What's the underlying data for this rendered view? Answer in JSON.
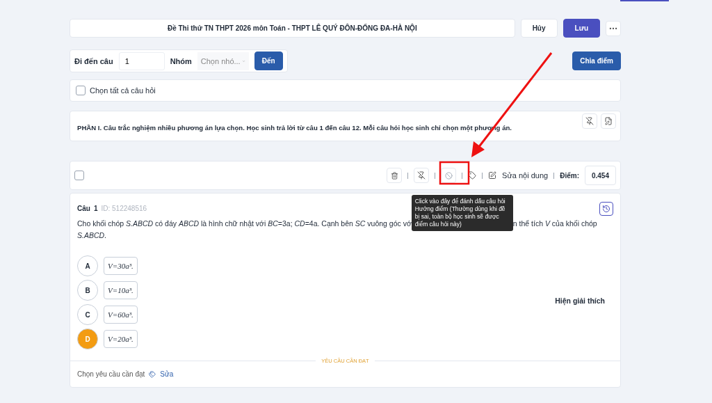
{
  "header": {
    "title": "Đề Thi thử TN THPT 2026 môn Toán - THPT LÊ QUÝ ĐÔN-ĐỐNG ĐA-HÀ NỘI",
    "buttons": [
      {
        "label": "Hủy",
        "kind": "secondary"
      },
      {
        "label": "Lưu",
        "kind": "primary"
      }
    ]
  },
  "goto": {
    "label": "Đi đến câu",
    "value": "1",
    "group_label": "Nhóm",
    "group_placeholder": "Chọn nhó...",
    "button": "Đến"
  },
  "distribute_button": "Chia điểm",
  "select_all": {
    "label": "Chọn tất cả câu hỏi",
    "checked": false
  },
  "section": {
    "text": "PHẦN I. Câu trắc nghiệm nhiều phương án lựa chọn. Học sinh trả lời từ câu 1 đến câu 12. Mỗi câu hỏi học sinh chỉ chọn một phương án."
  },
  "question_toolbar": {
    "checked": false,
    "edit_label": "Sửa nội dung",
    "score_label": "Điểm:",
    "score": "0.454"
  },
  "tooltip": "Click vào đây để đánh dấu câu hỏi Hưởng điểm (Thường dùng khi đề bị sai, toàn bộ học sinh sẽ được điểm câu hỏi này)",
  "question": {
    "number_label": "Câu",
    "number": "1",
    "id": "ID: 512248516",
    "text_before": "Cho khối chóp *S.ABCD* có đáy *ABCD* là hình chữ nhật với *BC*=3a; *CD*=4a. Cạnh bên *SC* vuông góc vớ",
    "text_after": "n thể tích *V* của khối chóp",
    "text_line2": "*S.ABCD*.",
    "options": [
      {
        "letter": "A",
        "answer": "V=30a³.",
        "selected": false
      },
      {
        "letter": "B",
        "answer": "V=10a³.",
        "selected": false
      },
      {
        "letter": "C",
        "answer": "V=60a³.",
        "selected": false
      },
      {
        "letter": "D",
        "answer": "V=20a³.",
        "selected": true
      }
    ],
    "explanation_button": "Hiện giải thích",
    "requirements_title": "YÊU CẦU CẦN ĐẠT",
    "requirements_label": "Chọn yêu cầu cần đạt",
    "requirements_edit": "Sửa"
  }
}
